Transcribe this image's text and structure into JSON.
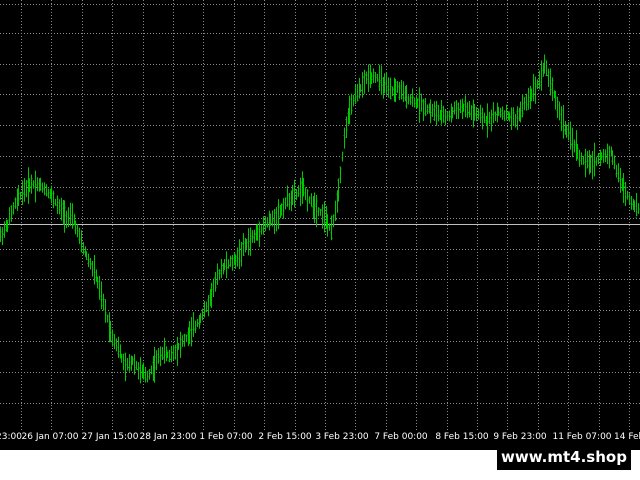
{
  "colors": {
    "background": "#000000",
    "grid": "#8a8a8a",
    "bid_line": "#c0c0c0",
    "bars": "#00c800",
    "axis_text": "#ffffff",
    "bottom_strip": "#ffffff"
  },
  "watermark": "www.mt4.shop",
  "chart_data": {
    "type": "line",
    "style": "ohlc-bars",
    "grid": true,
    "x_ticks": [
      "23:00",
      "26 Jan 07:00",
      "27 Jan 15:00",
      "28 Jan 23:00",
      "1 Feb 07:00",
      "2 Feb 15:00",
      "3 Feb 23:00",
      "7 Feb 00:00",
      "8 Feb 15:00",
      "9 Feb 23:00",
      "11 Feb 07:00",
      "14 Feb"
    ],
    "y_range": [
      0,
      100
    ],
    "bid_level": 49,
    "series": [
      {
        "values": [
          46,
          49,
          54,
          57,
          59,
          59,
          58,
          56,
          53,
          51,
          50,
          44,
          40,
          36,
          29,
          22,
          18,
          13,
          15,
          12,
          11,
          14,
          17,
          16,
          18,
          20,
          22,
          25,
          28,
          33,
          38,
          39,
          40,
          43,
          45,
          47,
          49,
          50,
          52,
          55,
          56,
          58,
          55,
          53,
          51,
          47,
          58,
          74,
          80,
          83,
          86,
          86,
          84,
          82,
          83,
          81,
          80,
          79,
          78,
          77,
          76,
          76,
          78,
          78,
          77,
          76,
          75,
          76,
          77,
          76,
          75,
          78,
          81,
          84,
          89,
          83,
          77,
          72,
          69,
          65,
          64,
          65,
          66,
          67,
          61,
          57,
          54,
          52
        ]
      }
    ]
  }
}
